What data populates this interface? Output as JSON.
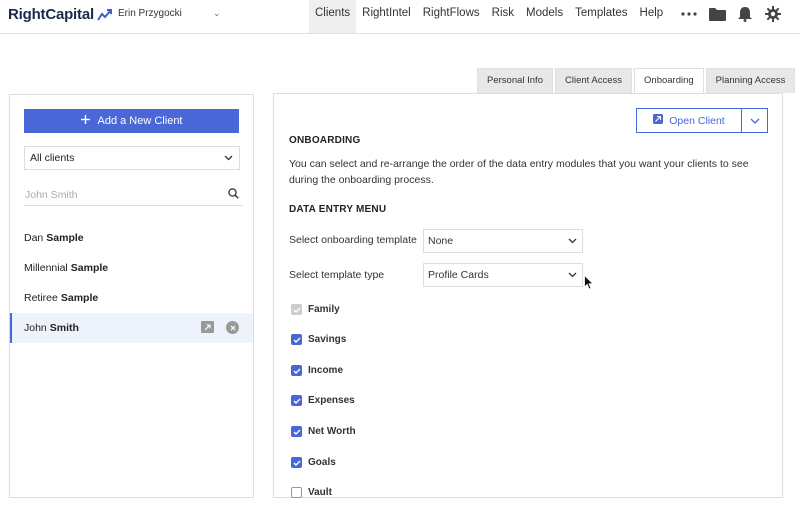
{
  "app": {
    "logo": "RightCapital",
    "user_name": "Erin Przygocki",
    "user_caret": "⌄"
  },
  "nav": [
    {
      "label": "Clients",
      "active": true
    },
    {
      "label": "RightIntel"
    },
    {
      "label": "RightFlows"
    },
    {
      "label": "Risk"
    },
    {
      "label": "Models"
    },
    {
      "label": "Templates"
    },
    {
      "label": "Help"
    }
  ],
  "tabs": [
    {
      "label": "Personal Info"
    },
    {
      "label": "Client Access"
    },
    {
      "label": "Onboarding",
      "active": true
    },
    {
      "label": "Planning Access"
    }
  ],
  "left": {
    "add_button": "Add a New Client",
    "filter_value": "All clients",
    "search_placeholder": "John Smith",
    "clients": [
      {
        "first": "Dan",
        "last": "Sample"
      },
      {
        "first": "Millennial",
        "last": "Sample"
      },
      {
        "first": "Retiree",
        "last": "Sample"
      },
      {
        "first": "John",
        "last": "Smith",
        "selected": true
      }
    ]
  },
  "right": {
    "open_client_label": "Open Client",
    "onboarding_title": "ONBOARDING",
    "description": "You can select and re-arrange the order of the data entry modules that you want your clients to see during the onboarding process.",
    "menu_title": "DATA ENTRY MENU",
    "template_label": "Select onboarding template",
    "template_value": "None",
    "type_label": "Select template type",
    "type_value": "Profile Cards",
    "modules": [
      {
        "label": "Family",
        "state": "disabled"
      },
      {
        "label": "Savings",
        "state": "checked"
      },
      {
        "label": "Income",
        "state": "checked"
      },
      {
        "label": "Expenses",
        "state": "checked"
      },
      {
        "label": "Net Worth",
        "state": "checked"
      },
      {
        "label": "Goals",
        "state": "checked"
      },
      {
        "label": "Vault",
        "state": "unchecked"
      }
    ]
  },
  "colors": {
    "accent": "#4967d6",
    "nav_active_bg": "#efefef",
    "selected_row_bg": "#eef2fb"
  }
}
